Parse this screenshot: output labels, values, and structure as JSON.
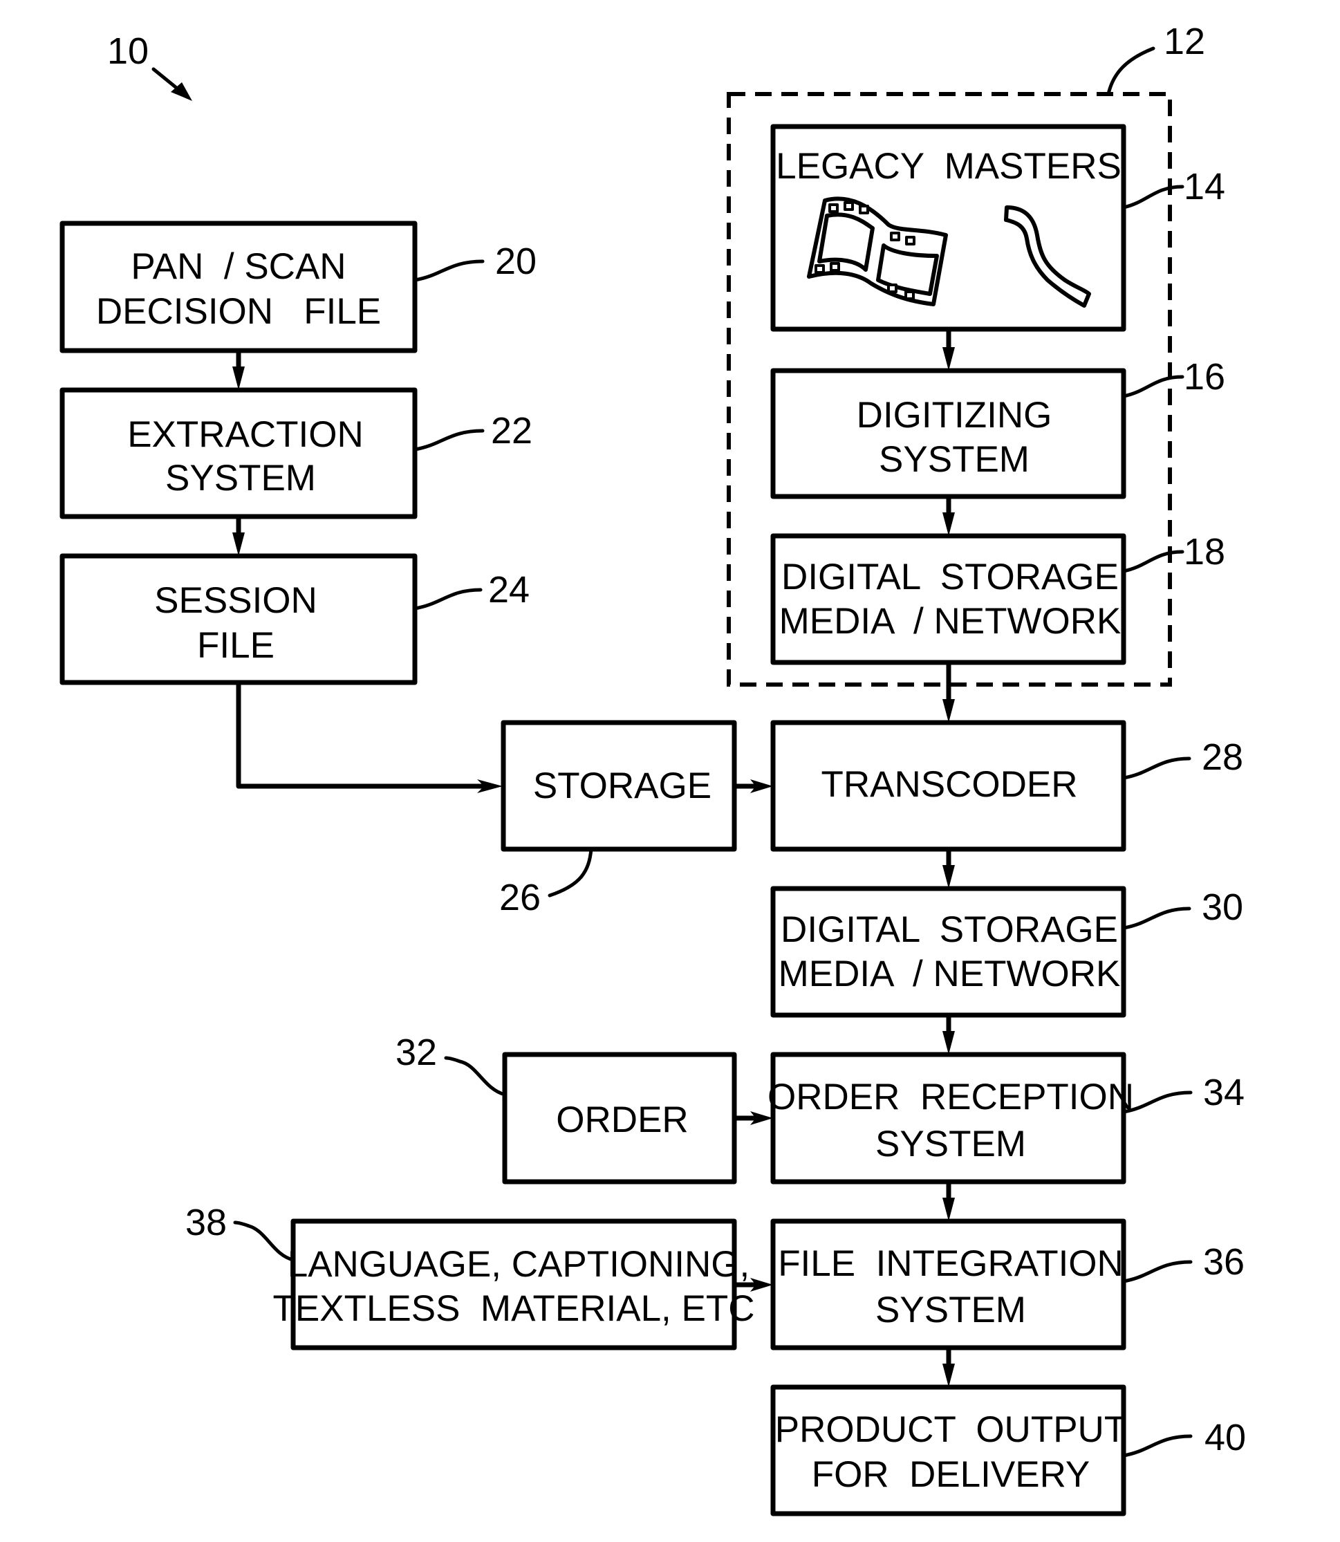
{
  "figure": {
    "reference_numeral": "10",
    "legacy_group": {
      "ref": "12"
    },
    "blocks": {
      "pan_scan": {
        "ref": "20",
        "lines": [
          "PAN  / SCAN",
          "DECISION   FILE"
        ]
      },
      "extraction": {
        "ref": "22",
        "lines": [
          "EXTRACTION",
          "SYSTEM"
        ]
      },
      "session": {
        "ref": "24",
        "lines": [
          "SESSION",
          "FILE"
        ]
      },
      "legacy_masters": {
        "ref": "14",
        "lines": [
          "LEGACY  MASTERS"
        ],
        "icons": [
          "film-strip-icon",
          "tape-strip-icon"
        ]
      },
      "digitizing": {
        "ref": "16",
        "lines": [
          "DIGITIZING",
          "SYSTEM"
        ]
      },
      "storage_media_1": {
        "ref": "18",
        "lines": [
          "DIGITAL  STORAGE",
          "MEDIA  / NETWORK"
        ]
      },
      "storage": {
        "ref": "26",
        "lines": [
          "STORAGE"
        ]
      },
      "transcoder": {
        "ref": "28",
        "lines": [
          "TRANSCODER"
        ]
      },
      "storage_media_2": {
        "ref": "30",
        "lines": [
          "DIGITAL  STORAGE",
          "MEDIA  / NETWORK"
        ]
      },
      "order": {
        "ref": "32",
        "lines": [
          "ORDER"
        ]
      },
      "order_reception": {
        "ref": "34",
        "lines": [
          "ORDER  RECEPTION",
          "SYSTEM"
        ]
      },
      "file_integration": {
        "ref": "36",
        "lines": [
          "FILE  INTEGRATION",
          "SYSTEM"
        ]
      },
      "language": {
        "ref": "38",
        "lines": [
          "LANGUAGE, CAPTIONING,",
          "TEXTLESS  MATERIAL, ETC"
        ]
      },
      "product_output": {
        "ref": "40",
        "lines": [
          "PRODUCT  OUTPUT",
          "FOR  DELIVERY"
        ]
      }
    }
  }
}
